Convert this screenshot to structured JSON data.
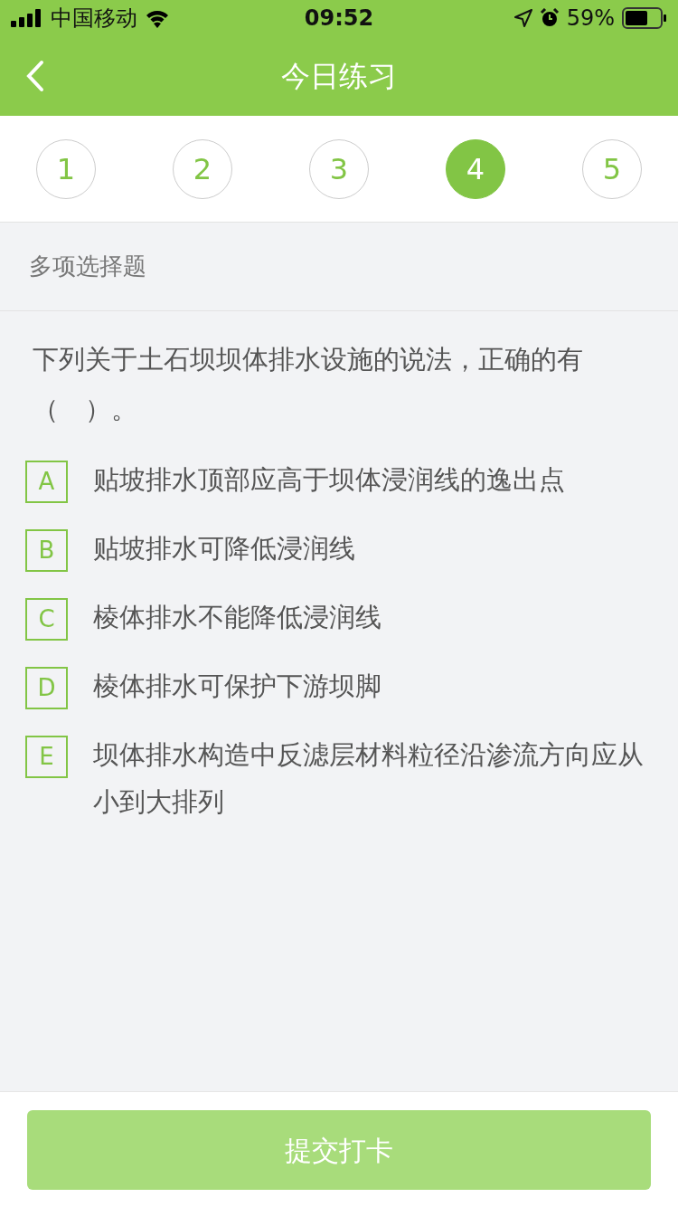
{
  "status_bar": {
    "carrier": "中国移动",
    "time": "09:52",
    "battery": "59%"
  },
  "header": {
    "title": "今日练习"
  },
  "question_tabs": [
    {
      "label": "1",
      "selected": false
    },
    {
      "label": "2",
      "selected": false
    },
    {
      "label": "3",
      "selected": false
    },
    {
      "label": "4",
      "selected": true
    },
    {
      "label": "5",
      "selected": false
    }
  ],
  "question_type": "多项选择题",
  "question": "下列关于土石坝坝体排水设施的说法，正确的有（　）。",
  "options": [
    {
      "letter": "A",
      "text": "贴坡排水顶部应高于坝体浸润线的逸出点",
      "selected": false
    },
    {
      "letter": "B",
      "text": "贴坡排水可降低浸润线",
      "selected": false
    },
    {
      "letter": "C",
      "text": "棱体排水不能降低浸润线",
      "selected": false
    },
    {
      "letter": "D",
      "text": "棱体排水可保护下游坝脚",
      "selected": false
    },
    {
      "letter": "E",
      "text": "坝体排水构造中反滤层材料粒径沿渗流方向应从小到大排列",
      "selected": false
    }
  ],
  "submit_button": {
    "label": "提交打卡",
    "disabled": true
  }
}
